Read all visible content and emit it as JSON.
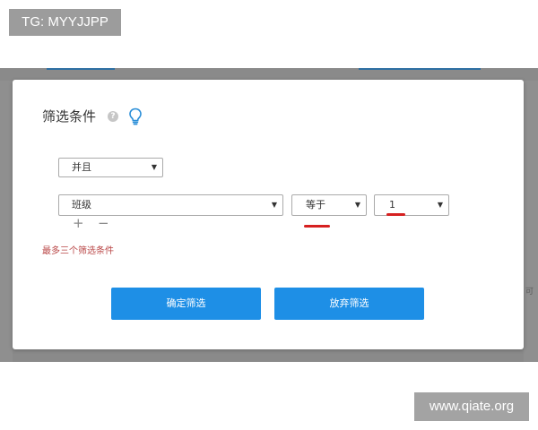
{
  "watermarks": {
    "top": "TG: MYYJJPP",
    "bottom": "www.qiate.org"
  },
  "modal": {
    "title": "筛选条件",
    "help_icon": "help-circle-icon",
    "hint_icon": "lightbulb-icon",
    "logic_select": "并且",
    "condition": {
      "field": "班级",
      "operator": "等于",
      "value": "1"
    },
    "add_label": "+",
    "remove_label": "−",
    "limit_note": "最多三个筛选条件",
    "confirm_label": "确定筛选",
    "discard_label": "放弃筛选"
  },
  "background": {
    "side_hint": "可"
  },
  "colors": {
    "primary": "#1e8fe6",
    "warning_text": "#b94646",
    "annotation": "#d62020",
    "overlay": "#8a8a8a",
    "hint_icon": "#2a8ed8"
  }
}
